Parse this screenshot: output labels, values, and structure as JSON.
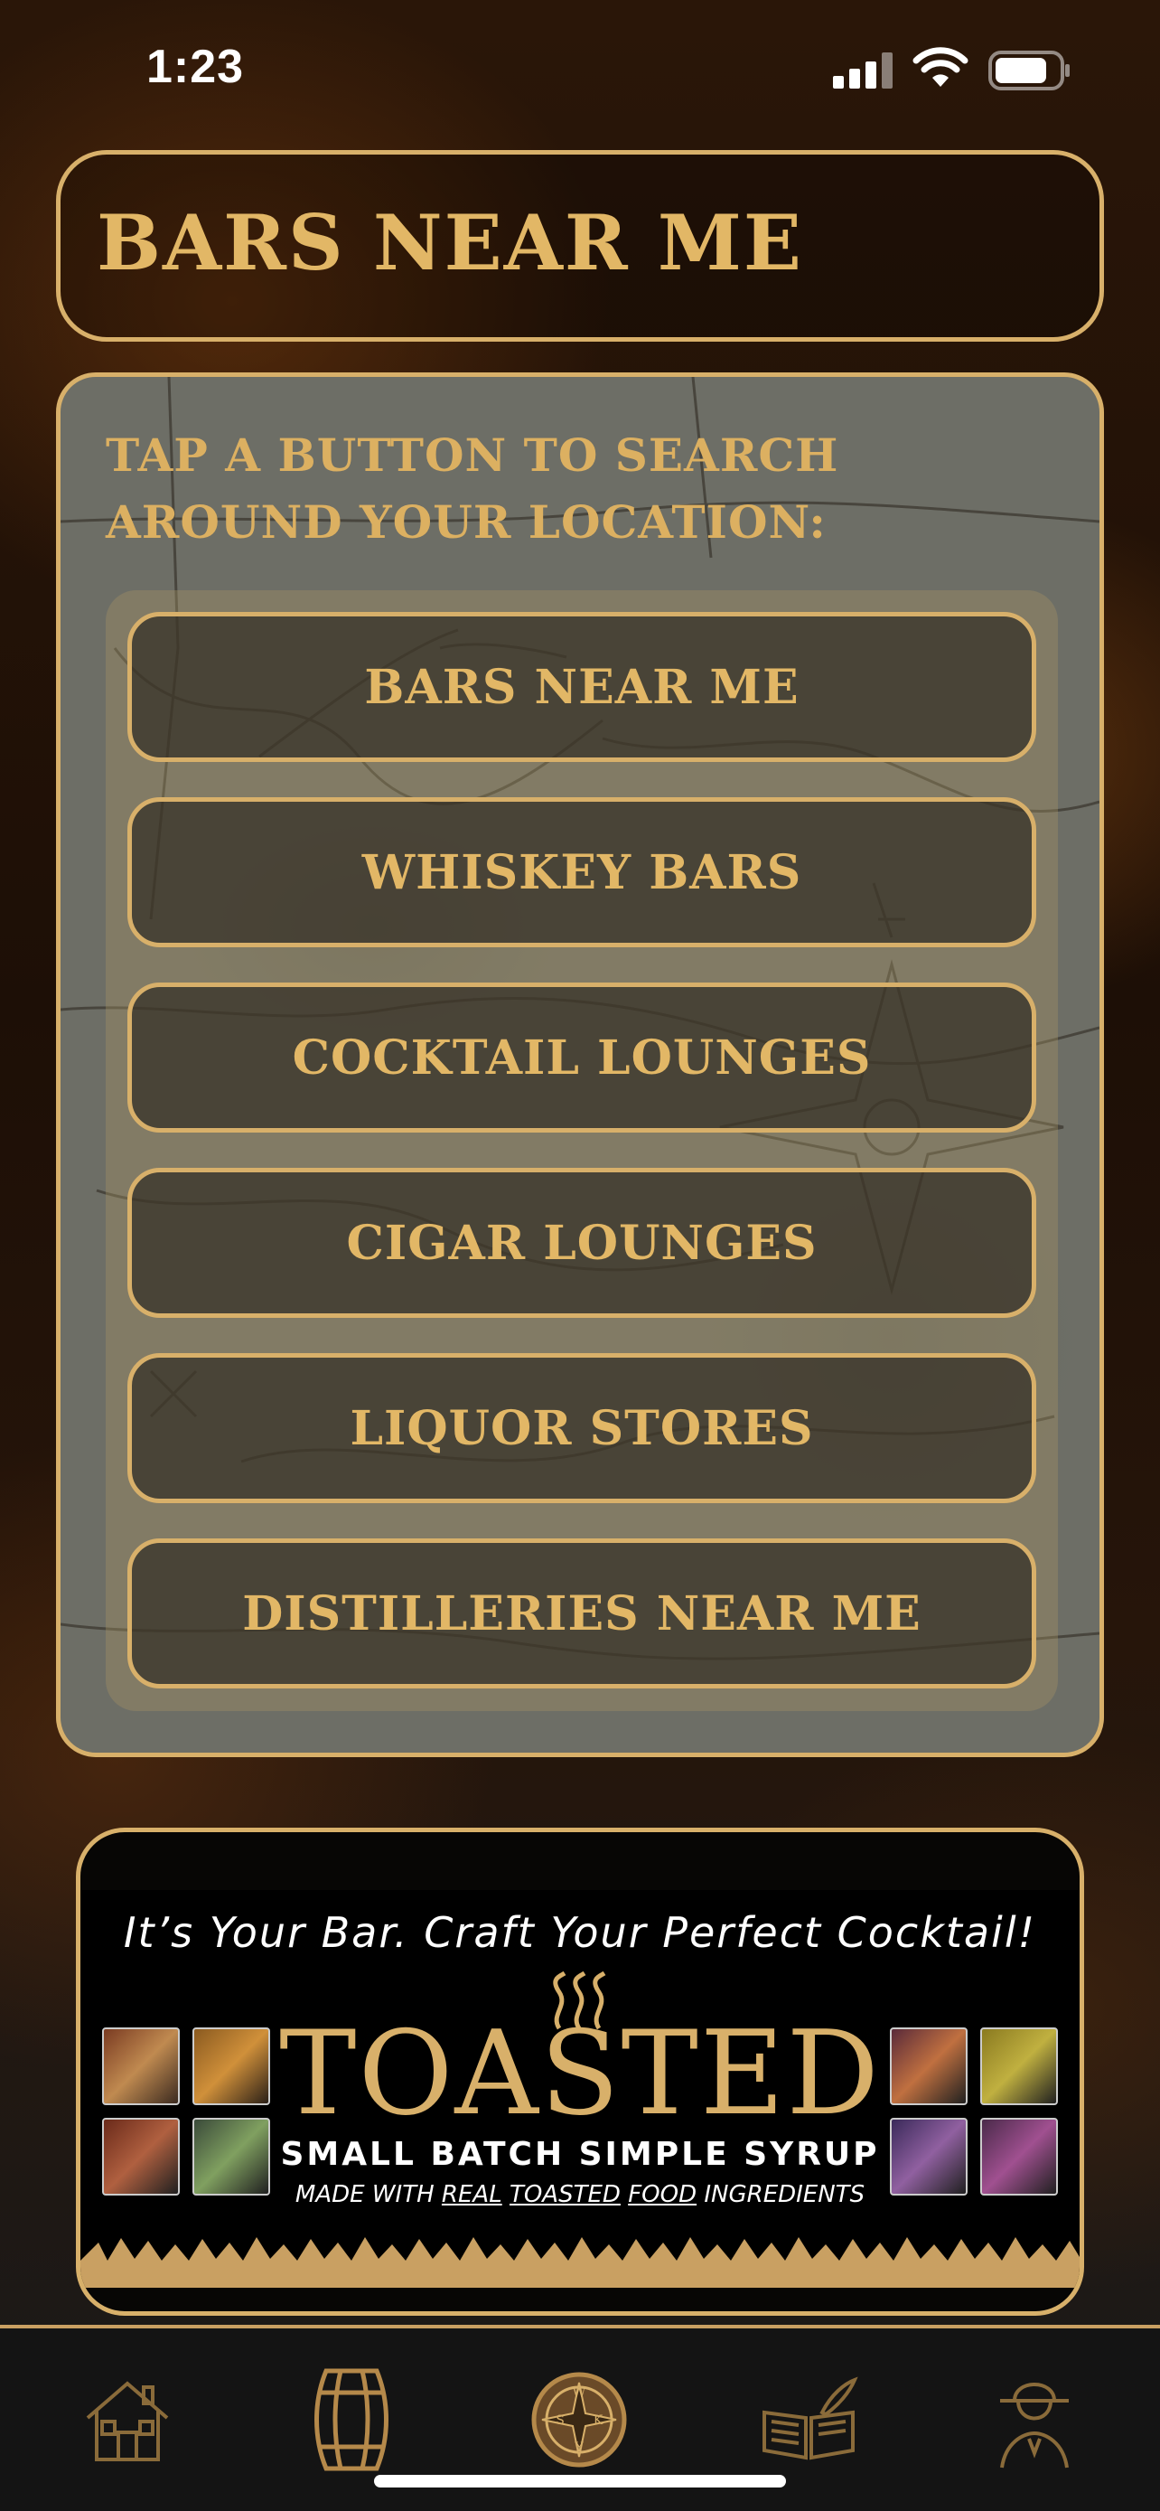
{
  "status_bar": {
    "time": "1:23",
    "icons": [
      "signal-icon",
      "wifi-icon",
      "battery-icon"
    ]
  },
  "header": {
    "title": "BARS NEAR ME"
  },
  "map_panel": {
    "prompt": "TAP A BUTTON TO SEARCH AROUND YOUR LOCATION:",
    "buttons": [
      {
        "label": "BARS NEAR ME"
      },
      {
        "label": "WHISKEY BARS"
      },
      {
        "label": "COCKTAIL LOUNGES"
      },
      {
        "label": "CIGAR LOUNGES"
      },
      {
        "label": "LIQUOR STORES"
      },
      {
        "label": "DISTILLERIES NEAR ME"
      }
    ]
  },
  "ad": {
    "tagline": "It’s Your Bar.  Craft Your Perfect Cocktail!",
    "brand": "TOASTED",
    "subtitle": "SMALL BATCH SIMPLE SYRUP",
    "detail_prefix": "MADE WITH ",
    "detail_real": "REAL",
    "detail_toasted": "TOASTED",
    "detail_food": "FOOD",
    "detail_suffix": " INGREDIENTS"
  },
  "tab_bar": {
    "tabs": [
      {
        "icon": "house-icon"
      },
      {
        "icon": "barrel-icon"
      },
      {
        "icon": "compass-badge-icon"
      },
      {
        "icon": "book-quill-icon"
      },
      {
        "icon": "detective-icon"
      }
    ]
  },
  "colors": {
    "gold": "#d8b06a",
    "dark": "#141414",
    "map_gray": "#6d6e66"
  }
}
